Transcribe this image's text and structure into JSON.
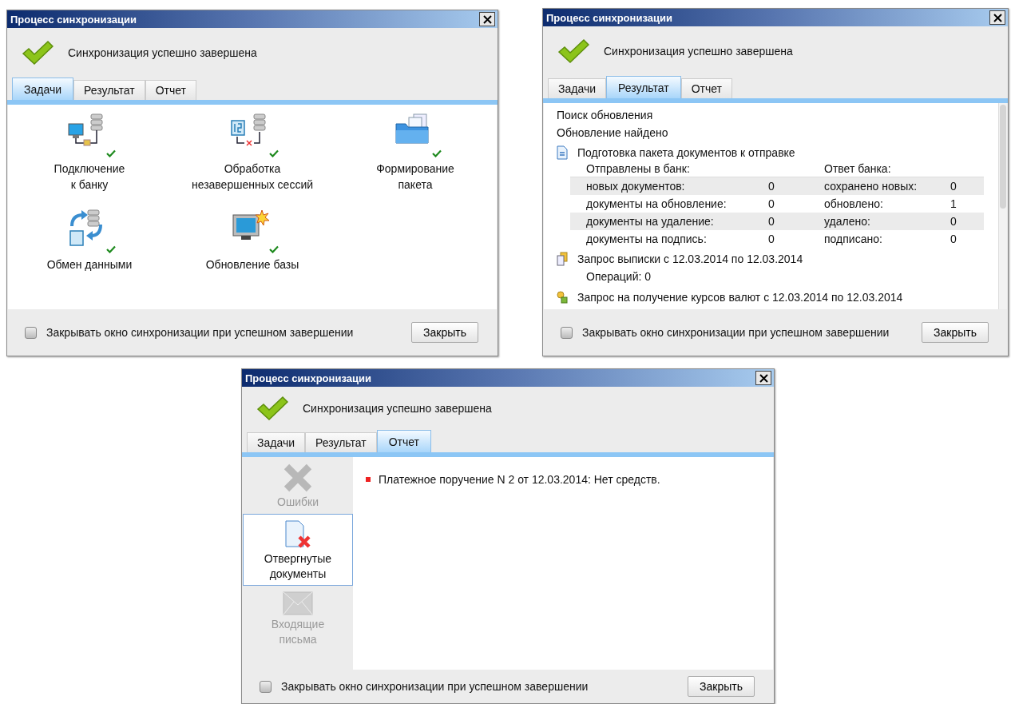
{
  "windows": [
    {
      "title": "Процесс синхронизации",
      "status": "Синхронизация успешно завершена",
      "tabs": [
        {
          "label": "Задачи",
          "selected": true
        },
        {
          "label": "Результат",
          "selected": false
        },
        {
          "label": "Отчет",
          "selected": false
        }
      ],
      "content": {
        "kind": "tasks",
        "tasks": [
          {
            "label": "Подключение\nк банку",
            "done": true
          },
          {
            "label": "Обработка\nнезавершенных сессий",
            "done": true
          },
          {
            "label": "Формирование\nпакета",
            "done": true
          },
          {
            "label": "Обмен данными",
            "done": true
          },
          {
            "label": "Обновление базы",
            "done": true
          }
        ]
      },
      "close_option": {
        "label": "Закрывать окно синхронизации при успешном завершении",
        "checked": false
      },
      "close_button": "Закрыть"
    },
    {
      "title": "Процесс синхронизации",
      "status": "Синхронизация успешно завершена",
      "tabs": [
        {
          "label": "Задачи",
          "selected": false
        },
        {
          "label": "Результат",
          "selected": true
        },
        {
          "label": "Отчет",
          "selected": false
        }
      ],
      "content": {
        "kind": "results",
        "lines": [
          "Поиск обновления",
          "Обновление найдено"
        ],
        "sections": [
          {
            "kind": "table",
            "title": "Подготовка пакета документов к отправке",
            "sent_header": "Отправлены в банк:",
            "reply_header": "Ответ банка:",
            "rows": [
              {
                "label": "новых документов:",
                "value": "0",
                "reply_label": "сохранено новых:",
                "reply_value": "0"
              },
              {
                "label": "документы на обновление:",
                "value": "0",
                "reply_label": "обновлено:",
                "reply_value": "1"
              },
              {
                "label": "документы на удаление:",
                "value": "0",
                "reply_label": "удалено:",
                "reply_value": "0"
              },
              {
                "label": "документы на подпись:",
                "value": "0",
                "reply_label": "подписано:",
                "reply_value": "0"
              }
            ]
          },
          {
            "kind": "statement",
            "title": "Запрос выписки с 12.03.2014 по 12.03.2014",
            "detail": "Операций: 0"
          },
          {
            "kind": "rates",
            "title": "Запрос на получение курсов валют с 12.03.2014 по 12.03.2014"
          }
        ]
      },
      "close_option": {
        "label": "Закрывать окно синхронизации при успешном завершении",
        "checked": false
      },
      "close_button": "Закрыть"
    },
    {
      "title": "Процесс синхронизации",
      "status": "Синхронизация успешно завершена",
      "tabs": [
        {
          "label": "Задачи",
          "selected": false
        },
        {
          "label": "Результат",
          "selected": false
        },
        {
          "label": "Отчет",
          "selected": true
        }
      ],
      "content": {
        "kind": "report",
        "categories": [
          {
            "label": "Ошибки",
            "disabled": true,
            "selected": false
          },
          {
            "label": "Отвергнутые\nдокументы",
            "disabled": false,
            "selected": true
          },
          {
            "label": "Входящие\nписьма",
            "disabled": true,
            "selected": false
          }
        ],
        "messages": [
          "Платежное поручение N 2 от 12.03.2014: Нет средств."
        ]
      },
      "close_option": {
        "label": "Закрывать окно синхронизации при успешном завершении",
        "checked": false
      },
      "close_button": "Закрыть"
    }
  ]
}
